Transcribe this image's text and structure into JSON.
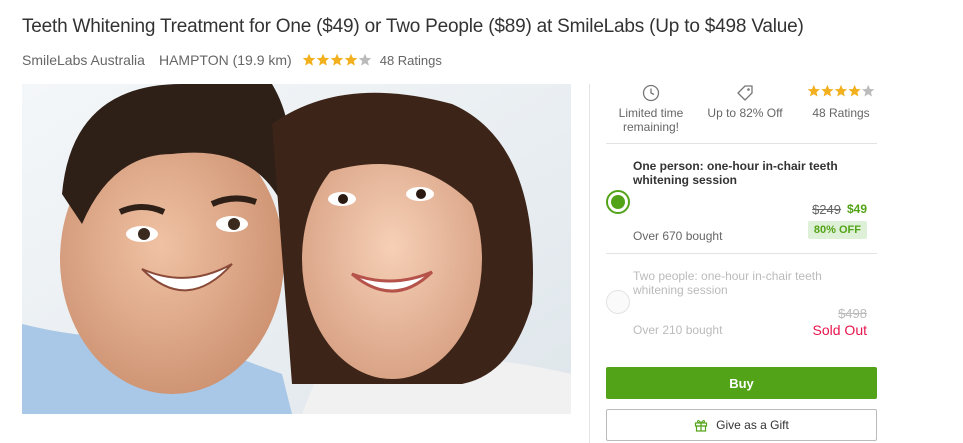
{
  "deal": {
    "title": "Teeth Whitening Treatment for One ($49) or Two People ($89) at SmileLabs (Up to $498 Value)",
    "merchant": "SmileLabs Australia",
    "location": "HAMPTON (19.9 km)",
    "rating": 4,
    "rating_max": 5,
    "ratings_text": "48 Ratings"
  },
  "stats": {
    "time_label": "Limited time remaining!",
    "discount_label": "Up to 82% Off",
    "ratings_label": "48 Ratings"
  },
  "options": [
    {
      "title": "One person: one-hour in-chair teeth whitening session",
      "old_price": "$249",
      "new_price": "$49",
      "badge": "80% OFF",
      "bought": "Over 670 bought",
      "selected": true
    },
    {
      "title": "Two people: one-hour in-chair teeth whitening session",
      "old_price": "$498",
      "bought": "Over 210 bought",
      "status": "Sold Out",
      "selected": false
    }
  ],
  "actions": {
    "buy_label": "Buy",
    "gift_label": "Give as a Gift"
  },
  "colors": {
    "accent_green": "#53a318",
    "star_gold": "#f2b01e",
    "sold_out_red": "#e8144c"
  },
  "icons": {
    "time": "clock-icon",
    "discount": "tag-icon",
    "gift": "gift-icon",
    "rating": "star-icon"
  }
}
